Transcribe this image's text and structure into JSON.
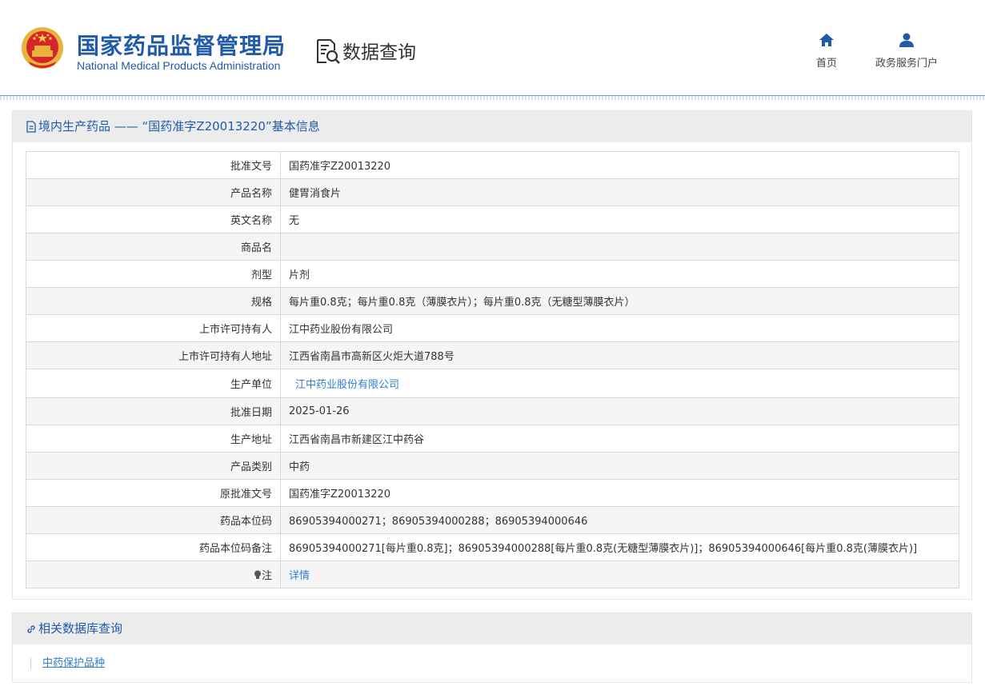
{
  "header": {
    "agency_cn": "国家药品监督管理局",
    "agency_en": "National Medical Products Administration",
    "section_title": "数据查询",
    "nav": {
      "home": "首页",
      "portal": "政务服务门户"
    }
  },
  "detail": {
    "title": "境内生产药品 —— “国药准字Z20013220”基本信息",
    "rows": [
      {
        "key": "批准文号",
        "value": "国药准字Z20013220"
      },
      {
        "key": "产品名称",
        "value": "健胃消食片"
      },
      {
        "key": "英文名称",
        "value": "无"
      },
      {
        "key": "商品名",
        "value": ""
      },
      {
        "key": "剂型",
        "value": "片剂"
      },
      {
        "key": "规格",
        "value": "每片重0.8克；每片重0.8克（薄膜衣片）；每片重0.8克（无糖型薄膜衣片）"
      },
      {
        "key": "上市许可持有人",
        "value": "江中药业股份有限公司"
      },
      {
        "key": "上市许可持有人地址",
        "value": "江西省南昌市高新区火炬大道788号"
      },
      {
        "key": "生产单位",
        "value": "江中药业股份有限公司"
      },
      {
        "key": "批准日期",
        "value": "2025-01-26"
      },
      {
        "key": "生产地址",
        "value": "江西省南昌市新建区江中药谷"
      },
      {
        "key": "产品类别",
        "value": "中药"
      },
      {
        "key": "原批准文号",
        "value": "国药准字Z20013220"
      },
      {
        "key": "药品本位码",
        "value": "86905394000271；86905394000288；86905394000646"
      },
      {
        "key": "药品本位码备注",
        "value": "86905394000271[每片重0.8克]；86905394000288[每片重0.8克(无糖型薄膜衣片)]；86905394000646[每片重0.8克(薄膜衣片)]"
      },
      {
        "key": "注",
        "value": "详情"
      }
    ]
  },
  "related": {
    "title": "相关数据库查询",
    "links": [
      "中药保护品种"
    ]
  },
  "colors": {
    "brand_blue": "#1f5ba8",
    "link_blue": "#2e7fd0"
  }
}
